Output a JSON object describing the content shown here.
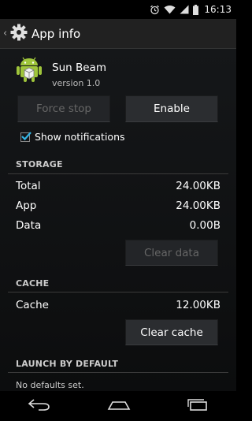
{
  "status_bar": {
    "time": "16:13"
  },
  "action_bar": {
    "title": "App info"
  },
  "app": {
    "name": "Sun Beam",
    "version": "version 1.0"
  },
  "buttons": {
    "force_stop": "Force stop",
    "enable": "Enable",
    "clear_data": "Clear data",
    "clear_cache": "Clear cache"
  },
  "notifications": {
    "label": "Show notifications",
    "checked": true
  },
  "storage": {
    "header": "STORAGE",
    "rows": [
      {
        "label": "Total",
        "value": "24.00KB"
      },
      {
        "label": "App",
        "value": "24.00KB"
      },
      {
        "label": "Data",
        "value": "0.00B"
      }
    ]
  },
  "cache": {
    "header": "CACHE",
    "label": "Cache",
    "value": "12.00KB"
  },
  "launch": {
    "header": "LAUNCH BY DEFAULT",
    "note": "No defaults set."
  },
  "colors": {
    "accent": "#33b5e5",
    "background": "#151719",
    "button": "#2b2d30"
  }
}
